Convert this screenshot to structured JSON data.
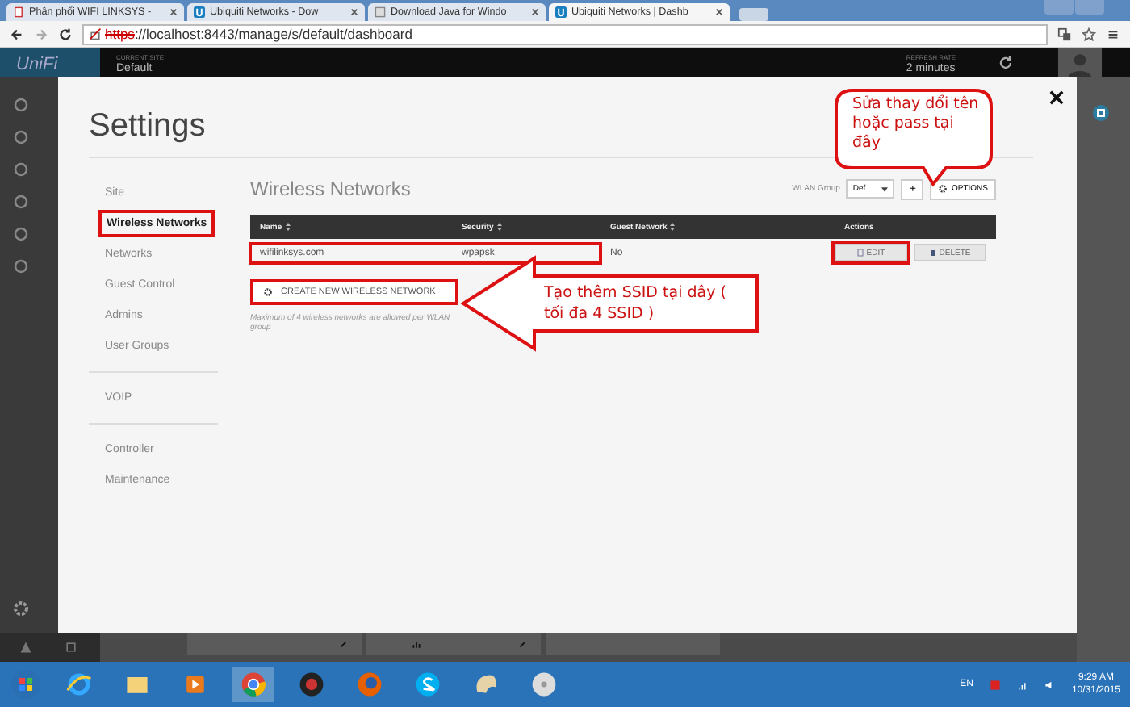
{
  "browser": {
    "tabs": [
      {
        "title": "Phân phối WIFI LINKSYS -",
        "kind": "doc",
        "selected": false
      },
      {
        "title": "Ubiquiti Networks - Dow",
        "kind": "ubnt",
        "selected": false
      },
      {
        "title": "Download Java for Windo",
        "kind": "page",
        "selected": false
      },
      {
        "title": "Ubiquiti Networks | Dashb",
        "kind": "ubnt",
        "selected": true
      }
    ],
    "address": {
      "scheme": "https",
      "rest": "://localhost:8443/manage/s/default/dashboard",
      "insecure": true
    }
  },
  "app_header": {
    "logo": "UniFi",
    "site_label": "CURRENT SITE",
    "site": "Default",
    "refresh_label": "REFRESH RATE",
    "refresh": "2 minutes"
  },
  "settings": {
    "title": "Settings",
    "nav_groups": [
      {
        "items": [
          {
            "label": "Site",
            "selected": false,
            "highlighted": false
          },
          {
            "label": "Wireless Networks",
            "selected": true,
            "highlighted": true
          },
          {
            "label": "Networks",
            "selected": false,
            "highlighted": false
          },
          {
            "label": "Guest Control",
            "selected": false,
            "highlighted": false
          },
          {
            "label": "Admins",
            "selected": false,
            "highlighted": false
          },
          {
            "label": "User Groups",
            "selected": false,
            "highlighted": false
          }
        ]
      },
      {
        "items": [
          {
            "label": "VOIP",
            "selected": false,
            "highlighted": false
          }
        ]
      },
      {
        "items": [
          {
            "label": "Controller",
            "selected": false,
            "highlighted": false
          },
          {
            "label": "Maintenance",
            "selected": false,
            "highlighted": false
          }
        ]
      }
    ],
    "section_title": "Wireless Networks",
    "wlan_group_label": "WLAN Group",
    "wlan_group": "Def...",
    "add_button": "+",
    "options_button": "OPTIONS",
    "table": {
      "columns": [
        {
          "label": "Name",
          "sortable": true
        },
        {
          "label": "Security",
          "sortable": true
        },
        {
          "label": "Guest Network",
          "sortable": true
        },
        {
          "label": "Actions",
          "sortable": false
        }
      ],
      "rows": [
        {
          "name": "wifilinksys.com",
          "security": "wpapsk",
          "guest_network": "No",
          "highlighted": true,
          "actions": [
            {
              "label": "EDIT",
              "kind": "edit",
              "highlighted": true
            },
            {
              "label": "DELETE",
              "kind": "delete",
              "highlighted": false
            }
          ]
        }
      ]
    },
    "create_button": {
      "label": "CREATE NEW WIRELESS NETWORK",
      "highlighted": true
    },
    "note": "Maximum of 4 wireless networks are allowed per WLAN group"
  },
  "annotations": [
    {
      "kind": "bubble",
      "text": "Sửa thay đổi tên hoặc pass tại đây"
    },
    {
      "kind": "arrow",
      "text": "Tạo thêm SSID tại đây ( tối đa 4 SSID )"
    }
  ],
  "taskbar": {
    "language": "EN",
    "time": "9:29 AM",
    "date": "10/31/2015"
  }
}
